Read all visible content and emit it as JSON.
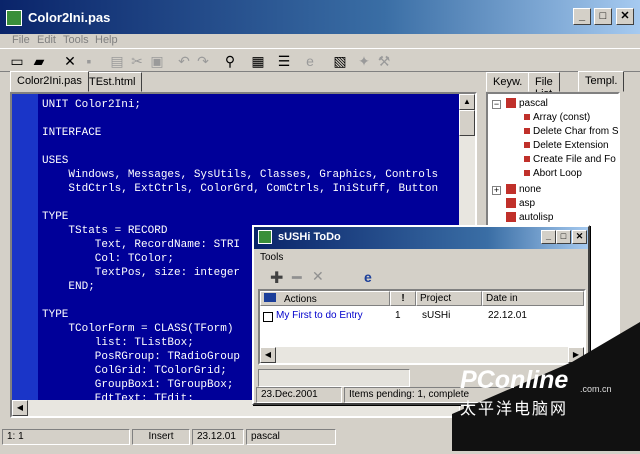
{
  "window": {
    "title": "Color2Ini.pas"
  },
  "menu": [
    "File",
    "Edit",
    "Tools",
    "Help"
  ],
  "editor_tabs": [
    {
      "label": "Color2Ini.pas",
      "active": true
    },
    {
      "label": "TEst.html",
      "active": false
    }
  ],
  "right_tabs": [
    {
      "label": "Keyw.",
      "active": false
    },
    {
      "label": "File List",
      "active": false
    },
    {
      "label": "Templ.",
      "active": true
    }
  ],
  "code": [
    "UNIT Color2Ini;",
    "",
    "INTERFACE",
    "",
    "USES",
    "    Windows, Messages, SysUtils, Classes, Graphics, Controls",
    "    StdCtrls, ExtCtrls, ColorGrd, ComCtrls, IniStuff, Button",
    "",
    "TYPE",
    "    TStats = RECORD",
    "        Text, RecordName: STRI",
    "        Col: TColor;",
    "        TextPos, size: integer",
    "    END;",
    "",
    "TYPE",
    "    TColorForm = CLASS(TForm)",
    "        list: TListBox;",
    "        PosRGroup: TRadioGroup",
    "        ColGrid: TColorGrid;",
    "        GroupBox1: TGroupBox;",
    "        EdtText: TEdit;"
  ],
  "tree": {
    "root": "pascal",
    "children": [
      "Array (const)",
      "Delete Char from S",
      "Delete Extension",
      "Create File and Fo",
      "Abort Loop"
    ],
    "others": [
      "none",
      "asp",
      "autolisp"
    ]
  },
  "status": {
    "position": "1: 1",
    "mode": "Insert",
    "date": "23.12.01",
    "language": "pascal"
  },
  "todo": {
    "title": "sUSHi ToDo",
    "menu": "Tools",
    "columns": [
      "Actions",
      "!",
      "Project",
      "Date in"
    ],
    "rows": [
      {
        "action": "My First to do Entry",
        "priority": "1",
        "project": "sUSHi",
        "date": "22.12.01"
      }
    ],
    "status_date": "23.Dec.2001",
    "status_text": "Items pending: 1, complete"
  },
  "watermark": {
    "brand": "PConline",
    "suffix": ".com.cn",
    "chinese": "太平洋电脑网"
  },
  "colors": {
    "editor_bg": "#000099",
    "title_start": "#0a246a",
    "tree_icon": "#c0302a"
  }
}
